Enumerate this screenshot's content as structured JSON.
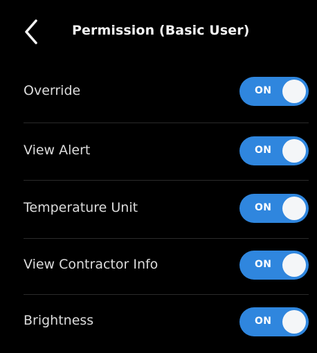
{
  "header": {
    "back_icon": "chevron-left-icon",
    "title": "Permission (Basic User)"
  },
  "permissions": [
    {
      "label": "Override",
      "state": "ON",
      "on": true
    },
    {
      "label": "View Alert",
      "state": "ON",
      "on": true
    },
    {
      "label": "Temperature Unit",
      "state": "ON",
      "on": true
    },
    {
      "label": "View Contractor Info",
      "state": "ON",
      "on": true
    },
    {
      "label": "Brightness",
      "state": "ON",
      "on": true
    }
  ],
  "colors": {
    "background": "#000000",
    "toggle_on": "#2f86de",
    "knob": "#f4f6f8",
    "text": "#dcdcdc",
    "divider": "#2b2b2b"
  }
}
